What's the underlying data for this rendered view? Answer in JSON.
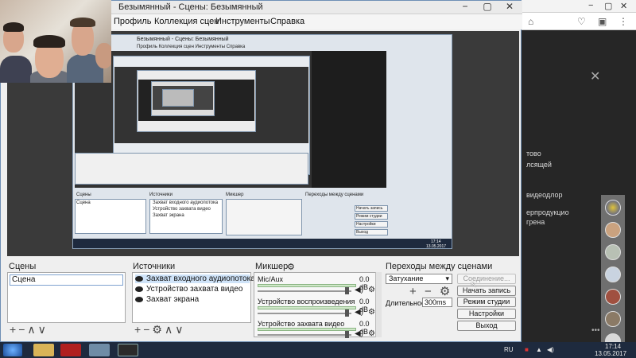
{
  "window": {
    "title": "Безымянный - Сцены: Безымянный",
    "min_label": "−",
    "max_label": "▢",
    "close_label": "✕"
  },
  "menu": [
    "Профиль",
    "Коллекция сцен",
    "Инструменты",
    "Справка"
  ],
  "panels": {
    "scenes_title": "Сцены",
    "sources_title": "Источники",
    "mixer_title": "Микшер",
    "transitions_title": "Переходы между сценами"
  },
  "scenes": [
    "Сцена"
  ],
  "sources": [
    "Захват входного аудиопотока",
    "Устройство захвата видео",
    "Захват экрана"
  ],
  "mixer": [
    {
      "name": "Mic/Aux",
      "db": "0.0 dB"
    },
    {
      "name": "Устройство воспроизведения",
      "db": "0.0 dB"
    },
    {
      "name": "Устройство захвата видео",
      "db": "0.0 dB"
    }
  ],
  "transitions": {
    "selected": "Затухание",
    "duration_label": "Длительность",
    "duration_value": "300ms"
  },
  "controls": {
    "studio_connect": "Соединение...",
    "start_recording": "Начать запись",
    "studio_mode": "Режим студии",
    "settings": "Настройки",
    "exit": "Выход"
  },
  "taskbar": {
    "language": "RU",
    "time": "17:14",
    "date": "13.05.2017"
  },
  "background_text": [
    "тово",
    "лсящей",
    "видеодлор",
    "ерпродукцио",
    "грена"
  ],
  "nested_preview_text": {
    "title": "Безымянный - Сцены: Безымянный",
    "menu": "Профиль  Коллекция сцен  Инструменты  Справка",
    "scenes": "Сцены",
    "sources": "Источники",
    "mixer": "Микшер",
    "transitions": "Переходы между сценами",
    "scene": "Сцена",
    "src1": "Захват входного аудиопотока",
    "src2": "Устройство захвата видео",
    "src3": "Захват экрана",
    "btn1": "Начать запись",
    "btn2": "Режим студии",
    "btn3": "Настройки",
    "btn4": "Выход",
    "time": "17:14",
    "date": "13.05.2017"
  }
}
